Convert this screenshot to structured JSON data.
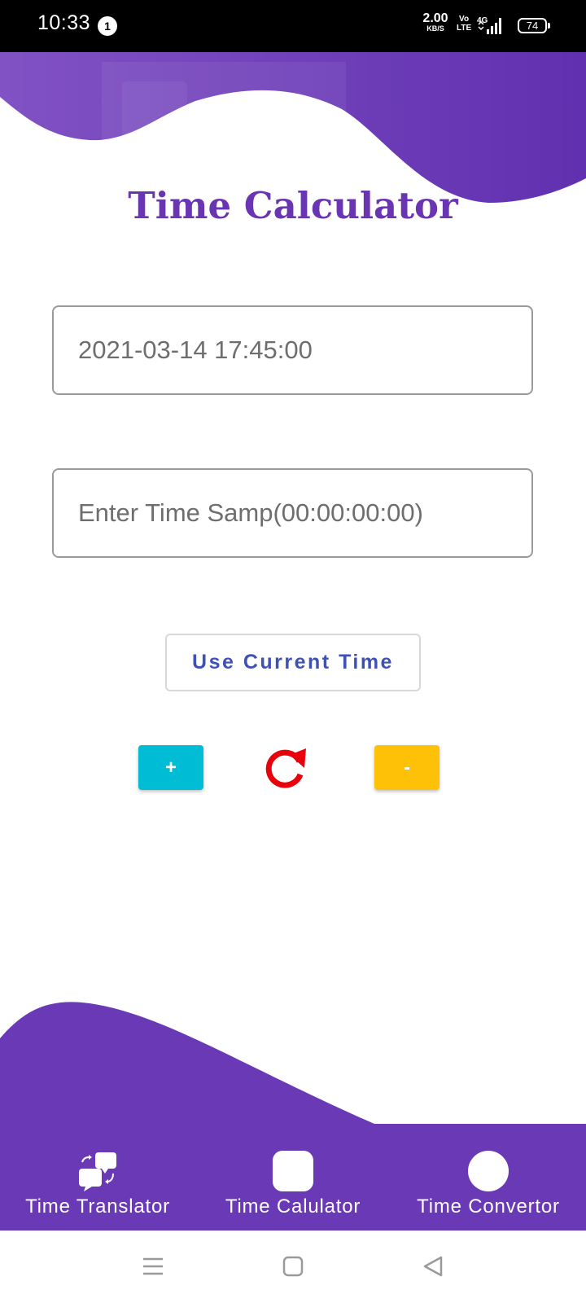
{
  "status_bar": {
    "time": "10:33",
    "notification_count": "1",
    "net_speed_value": "2.00",
    "net_speed_unit": "KB/S",
    "volte_top": "Vo",
    "volte_bottom": "LTE",
    "network_type": "4G",
    "battery_level": "74"
  },
  "theme": {
    "primary": "#6a39b6",
    "accent_plus": "#00bcd4",
    "accent_minus": "#ffc107",
    "reset_color": "#e8000b",
    "link_text": "#3f51b5"
  },
  "header": {
    "title": "Time Calculator"
  },
  "form": {
    "date_field_value": "2021-03-14 17:45:00",
    "timestamp_placeholder": "Enter Time Samp(00:00:00:00)",
    "use_current_time_label": "Use Current Time"
  },
  "actions": {
    "plus_label": "+",
    "minus_label": "-",
    "reset_icon": "refresh-icon"
  },
  "bottom_nav": {
    "items": [
      {
        "label": "Time Translator",
        "icon": "chat-swap-icon"
      },
      {
        "label": "Time Calulator",
        "icon": "square-icon"
      },
      {
        "label": "Time Convertor",
        "icon": "circle-icon"
      }
    ]
  },
  "system_nav": {
    "menu_icon": "menu-icon",
    "home_icon": "home-square-icon",
    "back_icon": "back-triangle-icon"
  }
}
